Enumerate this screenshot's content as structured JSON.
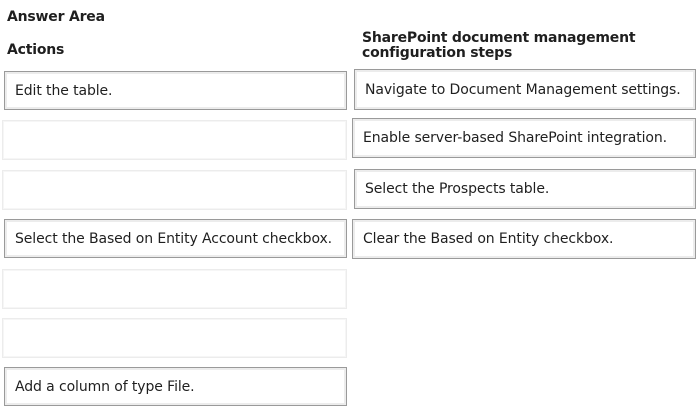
{
  "header": {
    "title": "Answer Area",
    "actions_heading": "Actions",
    "steps_heading": "SharePoint document management configuration steps"
  },
  "actions": [
    {
      "label": "Edit the table."
    },
    {
      "label": ""
    },
    {
      "label": ""
    },
    {
      "label": "Select the Based on Entity Account checkbox."
    },
    {
      "label": ""
    },
    {
      "label": ""
    },
    {
      "label": "Add a column of type File."
    }
  ],
  "steps": [
    {
      "label": "Navigate to Document Management settings."
    },
    {
      "label": "Enable server-based SharePoint integration."
    },
    {
      "label": "Select the Prospects table."
    },
    {
      "label": "Clear the Based on Entity checkbox."
    }
  ]
}
